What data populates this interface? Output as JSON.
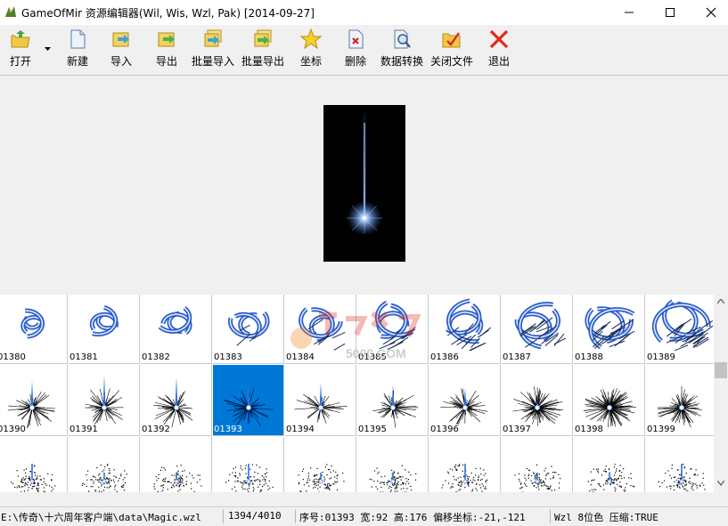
{
  "window": {
    "title": "GameOfMir 资源编辑器(Wil, Wis, Wzl, Pak) [2014-09-27]",
    "icon": "game-app-icon",
    "controls": [
      "minimize-icon",
      "maximize-icon",
      "close-icon"
    ]
  },
  "toolbar": {
    "open": "打开",
    "new": "新建",
    "import": "导入",
    "export": "导出",
    "batch_import": "批量导入",
    "batch_export": "批量导出",
    "coords": "坐标",
    "delete": "删除",
    "data_convert": "数据转换",
    "close_file": "关闭文件",
    "exit": "退出"
  },
  "grid": {
    "selected": "01393",
    "rows": [
      [
        "01380",
        "01381",
        "01382",
        "01383",
        "01384",
        "01385",
        "01386",
        "01387",
        "01388",
        "01389"
      ],
      [
        "01390",
        "01391",
        "01392",
        "01393",
        "01394",
        "01395",
        "01396",
        "01397",
        "01398",
        "01399"
      ],
      [
        "",
        "",
        "",
        "",
        "",
        "",
        "",
        "",
        "",
        ""
      ]
    ]
  },
  "watermark": {
    "domain": "5000.COM"
  },
  "status": {
    "path": "E:\\传奇\\十六周年客户端\\data\\Magic.wzl",
    "position": "1394/4010",
    "info": "序号:01393 宽:92 高:176 偏移坐标:-21,-121",
    "format": "Wzl 8位色 压缩:TRUE"
  },
  "colors": {
    "selection": "#0078d7",
    "spark": "#4a8cff",
    "swirl": "#1e4aa8"
  }
}
